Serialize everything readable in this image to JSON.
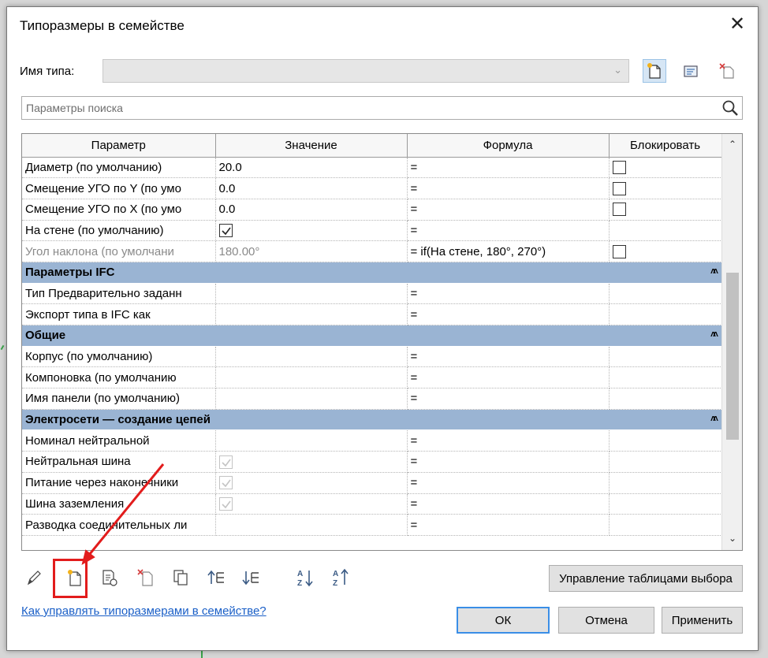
{
  "dialog": {
    "title": "Типоразмеры в семействе",
    "type_name_label": "Имя типа:",
    "type_name_value": "",
    "search_placeholder": "Параметры поиска"
  },
  "grid": {
    "columns": [
      "Параметр",
      "Значение",
      "Формула",
      "Блокировать"
    ],
    "rows": [
      {
        "kind": "row",
        "param": "Диаметр (по умолчанию)",
        "value": "20.0",
        "formula": "=",
        "lock": "box"
      },
      {
        "kind": "row",
        "param": "Смещение УГО по Y (по умо",
        "value": "0.0",
        "formula": "=",
        "lock": "box"
      },
      {
        "kind": "row",
        "param": "Смещение УГО по X (по умо",
        "value": "0.0",
        "formula": "=",
        "lock": "box"
      },
      {
        "kind": "row",
        "param": "На стене (по умолчанию)",
        "value": "",
        "value_check": "checked",
        "formula": "=",
        "lock": ""
      },
      {
        "kind": "row",
        "param": "Угол наклона (по умолчани",
        "value": "180.00°",
        "formula": "= if(На стене, 180°, 270°)",
        "lock": "box",
        "gray": true
      },
      {
        "kind": "group",
        "param": "Параметры IFC"
      },
      {
        "kind": "row",
        "param": "Тип Предварительно заданн",
        "value": "",
        "formula": "=",
        "lock": ""
      },
      {
        "kind": "row",
        "param": "Экспорт типа в IFC как",
        "value": "",
        "formula": "=",
        "lock": ""
      },
      {
        "kind": "group",
        "param": "Общие"
      },
      {
        "kind": "row",
        "param": "Корпус (по умолчанию)",
        "value": "",
        "formula": "=",
        "lock": ""
      },
      {
        "kind": "row",
        "param": "Компоновка (по умолчанию",
        "value": "",
        "formula": "=",
        "lock": ""
      },
      {
        "kind": "row",
        "param": "Имя панели (по умолчанию)",
        "value": "",
        "formula": "=",
        "lock": ""
      },
      {
        "kind": "group",
        "param": "Электросети — создание цепей"
      },
      {
        "kind": "row",
        "param": "Номинал нейтральной",
        "value": "",
        "formula": "=",
        "lock": ""
      },
      {
        "kind": "row",
        "param": "Нейтральная шина",
        "value": "",
        "value_check": "dim",
        "formula": "=",
        "lock": ""
      },
      {
        "kind": "row",
        "param": "Питание через наконечники",
        "value": "",
        "value_check": "dim",
        "formula": "=",
        "lock": ""
      },
      {
        "kind": "row",
        "param": "Шина заземления",
        "value": "",
        "value_check": "dim",
        "formula": "=",
        "lock": ""
      },
      {
        "kind": "row",
        "param": "Разводка соединительных ли",
        "value": "",
        "formula": "=",
        "lock": ""
      }
    ]
  },
  "bottom_toolbar": {
    "icons": [
      "pencil-icon",
      "new-type-icon",
      "rename-type-icon",
      "delete-type-icon",
      "duplicate-type-icon",
      "move-up-icon",
      "move-down-icon",
      "sort-ascending-icon",
      "sort-descending-icon"
    ]
  },
  "buttons": {
    "lookup_tables": "Управление таблицами выбора",
    "ok": "ОК",
    "cancel": "Отмена",
    "apply": "Применить"
  },
  "help_link": "Как управлять типоразмерами в семействе?",
  "colors": {
    "group_header": "#9ab4d3",
    "annotation": "#e21c1c",
    "link": "#1a5fc7"
  }
}
